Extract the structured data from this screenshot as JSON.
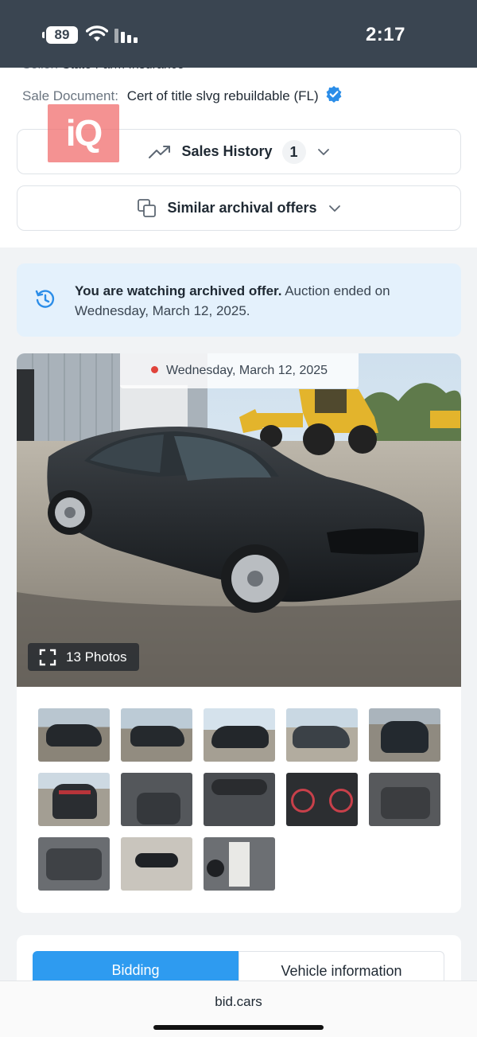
{
  "status_bar": {
    "battery": "89",
    "time": "2:17"
  },
  "listing": {
    "seller_label": "Seller:",
    "seller_value": "State Farm Insurance",
    "sale_document_label": "Sale Document:",
    "sale_document_value": "Cert of title slvg rebuildable (FL)"
  },
  "watermark": {
    "text": "iQ"
  },
  "sales_history": {
    "label": "Sales History",
    "count": "1"
  },
  "similar_offers": {
    "label": "Similar archival offers"
  },
  "notice": {
    "bold": "You are watching archived offer.",
    "rest": " Auction ended on Wednesday, March 12, 2025."
  },
  "gallery": {
    "date": "Wednesday, March 12, 2025",
    "photos_label": "13 Photos",
    "thumbnails": [
      "car-side-front-view",
      "car-side-view",
      "car-rear-quarter-view",
      "car-front-quarter-view",
      "car-front-view",
      "car-rear-view",
      "interior-front-seats",
      "dashboard-view",
      "instrument-cluster",
      "rear-seats",
      "engine-bay",
      "loose-part",
      "door-jamb-label"
    ]
  },
  "tabs": {
    "bidding": "Bidding",
    "vehicle_information": "Vehicle information"
  },
  "browser": {
    "url": "bid.cars"
  },
  "colors": {
    "accent": "#2e9bf0",
    "status_bar": "#3a4551",
    "notice_bg": "#e4f1fc",
    "verified": "#2b8de8",
    "live_dot": "#e0433b"
  }
}
